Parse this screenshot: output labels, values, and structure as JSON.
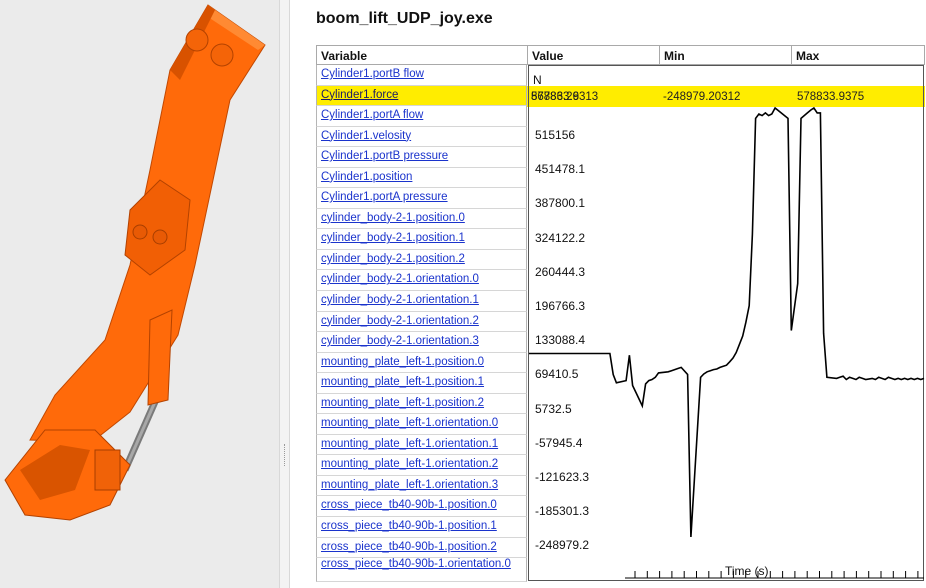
{
  "app": {
    "title": "boom_lift_UDP_joy.exe"
  },
  "table": {
    "headers": {
      "variable": "Variable",
      "value": "Value",
      "min": "Min",
      "max": "Max"
    },
    "rows": [
      "Cylinder1.portB flow",
      "Cylinder1.force",
      "Cylinder1.portA flow",
      "Cylinder1.velosity",
      "Cylinder1.portB pressure",
      "Cylinder1.position",
      "Cylinder1.portA pressure",
      "cylinder_body-2-1.position.0",
      "cylinder_body-2-1.position.1",
      "cylinder_body-2-1.position.2",
      "cylinder_body-2-1.orientation.0",
      "cylinder_body-2-1.orientation.1",
      "cylinder_body-2-1.orientation.2",
      "cylinder_body-2-1.orientation.3",
      "mounting_plate_left-1.position.0",
      "mounting_plate_left-1.position.1",
      "mounting_plate_left-1.position.2",
      "mounting_plate_left-1.orientation.0",
      "mounting_plate_left-1.orientation.1",
      "mounting_plate_left-1.orientation.2",
      "mounting_plate_left-1.orientation.3",
      "cross_piece_tb40-90b-1.position.0",
      "cross_piece_tb40-90b-1.position.1",
      "cross_piece_tb40-90b-1.position.2",
      "cross_piece_tb40-90b-1.orientation.0"
    ],
    "selected_index": 1,
    "selected_values": {
      "value": "86786.26313",
      "min": "-248979.20312",
      "max": "578833.9375"
    }
  },
  "chart_data": {
    "type": "line",
    "unit_label": "N",
    "xlabel": "Time (s)",
    "top_value_label": "578833.9",
    "y_ticks": [
      "515156",
      "451478.1",
      "387800.1",
      "324122.2",
      "260444.3",
      "196766.3",
      "133088.4",
      "69410.5",
      "5732.5",
      "-57945.4",
      "-121623.3",
      "-185301.3",
      "-248979.2"
    ],
    "ylim": [
      -248979.2,
      578833.9
    ],
    "series": [
      {
        "color": "#000000",
        "x": [
          0.0,
          0.25,
          0.26,
          0.27,
          0.3,
          0.31,
          0.32,
          0.35,
          0.36,
          0.37,
          0.38,
          0.39,
          0.4,
          0.43,
          0.44,
          0.45,
          0.46,
          0.47,
          0.49,
          0.5,
          0.53,
          0.54,
          0.55,
          0.56,
          0.57,
          0.58,
          0.59,
          0.6,
          0.61,
          0.62,
          0.63,
          0.64,
          0.65,
          0.66,
          0.67,
          0.68,
          0.69,
          0.7,
          0.71,
          0.72,
          0.73,
          0.74,
          0.75,
          0.76,
          0.8,
          0.81,
          0.83,
          0.84,
          0.86,
          0.87,
          0.88,
          0.89,
          0.9,
          0.91,
          0.92,
          0.95,
          0.96,
          0.97,
          0.98,
          0.99,
          1.0,
          1.01,
          1.02,
          1.03,
          1.04,
          1.06,
          1.07,
          1.08,
          1.1,
          1.11,
          1.12,
          1.13,
          1.14,
          1.15,
          1.16,
          1.17,
          1.18,
          1.19,
          1.2,
          1.21,
          1.22
        ],
        "y": [
          133088,
          133088,
          95000,
          80000,
          84000,
          130000,
          75000,
          38000,
          78000,
          84000,
          86000,
          90000,
          98000,
          100000,
          102000,
          104000,
          106000,
          108000,
          95000,
          -200000,
          90000,
          96000,
          100000,
          102000,
          104000,
          105000,
          108000,
          110000,
          112000,
          118000,
          125000,
          135000,
          150000,
          165000,
          190000,
          220000,
          350000,
          560000,
          568000,
          565000,
          570000,
          565000,
          568000,
          578833,
          560000,
          175000,
          260000,
          560000,
          570000,
          575000,
          578833,
          570000,
          570000,
          170000,
          90000,
          88000,
          90000,
          92000,
          86000,
          90000,
          88000,
          86000,
          90000,
          88000,
          86000,
          88000,
          86000,
          90000,
          86000,
          90000,
          88000,
          86000,
          88000,
          86000,
          88000,
          86000,
          88000,
          86000,
          88000,
          86000,
          88000
        ]
      }
    ]
  }
}
